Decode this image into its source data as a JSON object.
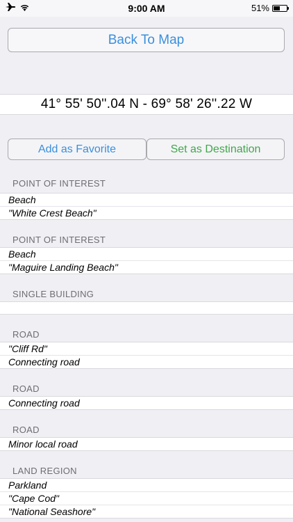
{
  "status_bar": {
    "airplane_icon": "airplane-icon",
    "wifi_icon": "wifi-icon",
    "time": "9:00 AM",
    "battery_percent": "51%",
    "battery_level": 0.51
  },
  "header": {
    "back_button_label": "Back To Map"
  },
  "coordinates": "41° 55' 50''.04 N  -  69° 58' 26''.22 W",
  "actions": {
    "favorite_label": "Add as Favorite",
    "destination_label": "Set as Destination"
  },
  "sections": [
    {
      "header": "POINT OF INTEREST",
      "lines": [
        "Beach",
        "\"White Crest Beach\""
      ]
    },
    {
      "header": "POINT OF INTEREST",
      "lines": [
        "Beach",
        "\"Maguire Landing Beach\""
      ]
    },
    {
      "header": "SINGLE BUILDING",
      "lines": []
    },
    {
      "header": "ROAD",
      "lines": [
        "\"Cliff Rd\"",
        "Connecting road"
      ]
    },
    {
      "header": "ROAD",
      "lines": [
        "Connecting road"
      ]
    },
    {
      "header": "ROAD",
      "lines": [
        "Minor local road"
      ]
    },
    {
      "header": "LAND REGION",
      "lines": [
        "Parkland",
        "\"Cape Cod\"",
        "\"National Seashore\""
      ]
    }
  ],
  "colors": {
    "link_blue": "#3a8fdc",
    "destination_green": "#3fa84a",
    "background": "#efeff4"
  }
}
